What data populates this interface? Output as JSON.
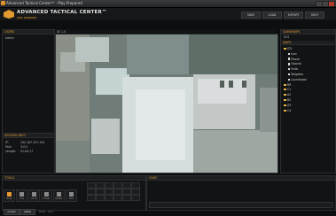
{
  "window": {
    "title": "Advanced Tactical Centerᵀᴹ - Play Prepared"
  },
  "brand": {
    "name": "ADVANCED TACTICAL CENTER™",
    "tagline": "play prepared"
  },
  "nav": {
    "save": "SAVE",
    "load": "LOAD",
    "export": "EXPORT",
    "help": "HELP"
  },
  "users": {
    "header": "USERS",
    "item": "Admin"
  },
  "session": {
    "header": "SESSION INFO",
    "ip_label": "IP:",
    "ip": "192.167.357.152",
    "port_label": "Port:",
    "port": "3131",
    "length_label": "Length:",
    "length": "01:00:17"
  },
  "map": {
    "header": "SE 1.0"
  },
  "gamemaps": {
    "header": "GAMEMAPS",
    "selected": "ECS",
    "maps_header": "MAPS",
    "tree": [
      {
        "label": "STL",
        "type": "folder"
      },
      {
        "label": "Icon",
        "type": "file"
      },
      {
        "label": "Places",
        "type": "file"
      },
      {
        "label": "Tutorial",
        "type": "file"
      },
      {
        "label": "Trails",
        "type": "file"
      },
      {
        "label": "Tailgates",
        "type": "file"
      },
      {
        "label": "Launchpad",
        "type": "file"
      },
      {
        "label": "RR",
        "type": "folder"
      },
      {
        "label": "C1",
        "type": "folder"
      },
      {
        "label": "A2",
        "type": "folder"
      },
      {
        "label": "B2",
        "type": "folder"
      },
      {
        "label": "A3",
        "type": "folder"
      },
      {
        "label": "C4",
        "type": "folder"
      }
    ]
  },
  "tools": {
    "header": "TOOLS",
    "items": [
      "Move",
      "Line",
      "Circle",
      "Eraser",
      "Marker",
      "Text"
    ]
  },
  "chat": {
    "header": "CHAT"
  },
  "bottom": {
    "clear": "CLEAR",
    "undo": "UNDO",
    "status": "Draw - Lvl 1"
  }
}
